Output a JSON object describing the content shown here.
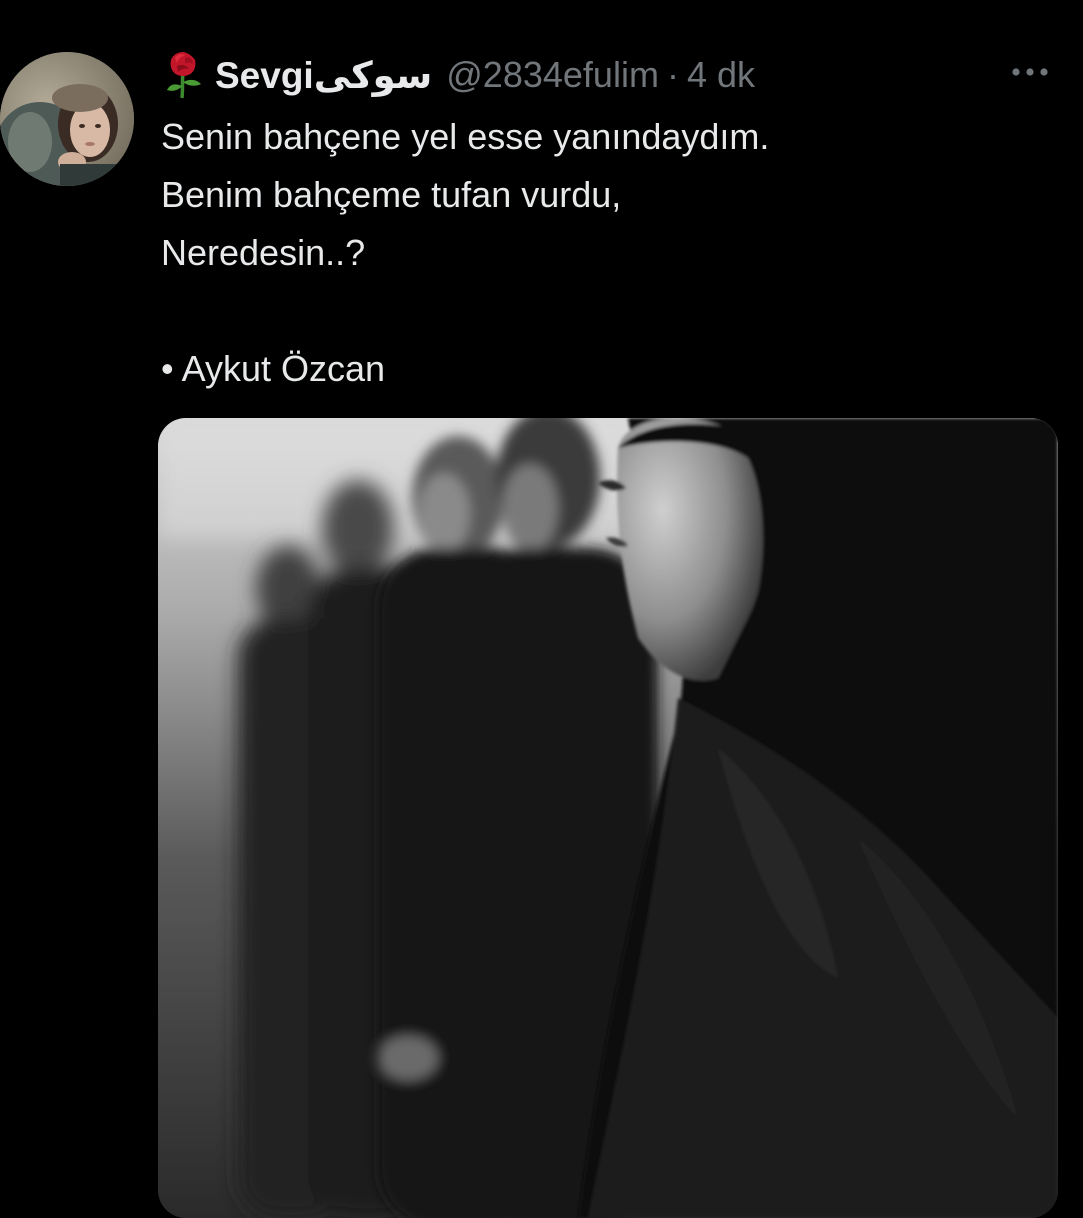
{
  "tweet": {
    "display_name": "Sevgiسوکی",
    "handle": "@2834efulim",
    "separator": "·",
    "time": "4 dk",
    "text_lines": [
      "Senin bahçene yel esse yanındaydım.",
      "Benim bahçeme tufan vurdu,",
      "Neredesin..?",
      "",
      "• Aykut Özcan"
    ]
  },
  "icons": {
    "name_emoji": "rose-icon",
    "more": "more-horizontal-icon"
  },
  "colors": {
    "background": "#000000",
    "primary_text": "#e7e9ea",
    "secondary_text": "#71767b"
  }
}
